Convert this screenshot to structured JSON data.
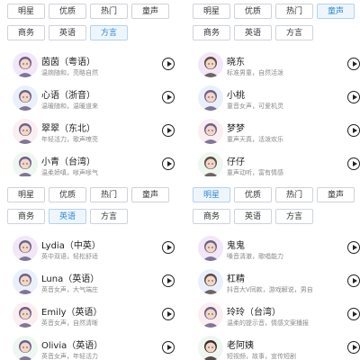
{
  "panels": [
    {
      "tabs": [
        "明星",
        "优质",
        "热门",
        "童声",
        "商务",
        "英语",
        "方言"
      ],
      "active": 6,
      "rows": [
        {
          "name": "茵茵（粤语）",
          "desc": "温婉随和，亮略自然",
          "avatar": "girl-icon"
        },
        {
          "name": "心语（浙音）",
          "desc": "温暖随和，温暖道来",
          "avatar": "girl-icon"
        },
        {
          "name": "翠翠（东北）",
          "desc": "年轻活力，歌声嘹亮",
          "avatar": "girl-icon"
        },
        {
          "name": "小青（台湾）",
          "desc": "温柔娇嗔，嗲声嗲气",
          "avatar": "girl-icon"
        }
      ]
    },
    {
      "tabs": [
        "明星",
        "优质",
        "热门",
        "童声",
        "商务",
        "英语",
        "方言"
      ],
      "active": 3,
      "rows": [
        {
          "name": "晓东",
          "desc": "标准男童，自然活泼",
          "avatar": "boy-icon"
        },
        {
          "name": "小桃",
          "desc": "童音女声，可爱机灵",
          "avatar": "girl-icon"
        },
        {
          "name": "梦梦",
          "desc": "童声天真，活泼欢乐",
          "avatar": "girl-icon"
        },
        {
          "name": "仔仔",
          "desc": "童声动听，富有情感",
          "avatar": "boy-icon"
        }
      ]
    },
    {
      "tabs": [
        "明星",
        "优质",
        "热门",
        "童声",
        "商务",
        "英语",
        "方言"
      ],
      "active": 5,
      "rows": [
        {
          "name": "Lydia（中英）",
          "desc": "英中双语，轻松舒适",
          "avatar": "girl-icon"
        },
        {
          "name": "Luna（英语）",
          "desc": "英音女声，大气端庄",
          "avatar": "girl-icon"
        },
        {
          "name": "Emily（英语）",
          "desc": "英音女声，自然清晰",
          "avatar": "girl-icon"
        },
        {
          "name": "Olivia（英语）",
          "desc": "英音女声，年轻活力",
          "avatar": "girl-icon"
        }
      ]
    },
    {
      "tabs": [
        "明星",
        "优质",
        "热门",
        "童声",
        "商务",
        "英语",
        "方言"
      ],
      "active": 0,
      "rows": [
        {
          "name": "鬼鬼",
          "desc": "嗓音清澈，歌唱能力",
          "avatar": "girl-icon"
        },
        {
          "name": "杠精",
          "desc": "抖音大V同款，游戏解说，男自",
          "avatar": "boy-icon"
        },
        {
          "name": "玲玲（台湾）",
          "desc": "温柔的提示音，情感文案播报",
          "avatar": "girl-icon"
        },
        {
          "name": "老阿姨",
          "desc": "短视频，故事，宣传短剧",
          "avatar": "woman-icon"
        }
      ]
    }
  ],
  "colors": {
    "accent": "#2f86d6",
    "border": "#cfd3d8"
  }
}
